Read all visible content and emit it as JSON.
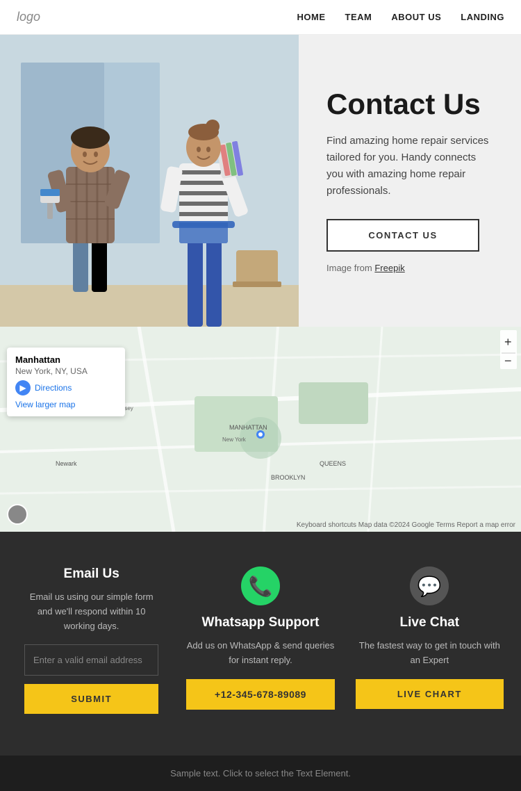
{
  "nav": {
    "logo": "logo",
    "links": [
      {
        "label": "HOME",
        "href": "#"
      },
      {
        "label": "TEAM",
        "href": "#"
      },
      {
        "label": "ABOUT US",
        "href": "#"
      },
      {
        "label": "LANDING",
        "href": "#"
      }
    ]
  },
  "hero": {
    "title": "Contact Us",
    "description": "Find amazing home repair services tailored for you. Handy connects you with amazing home repair professionals.",
    "contact_button": "CONTACT US",
    "image_credit_prefix": "Image from ",
    "image_credit_link": "Freepik"
  },
  "map": {
    "location_name": "Manhattan",
    "location_sub": "New York, NY, USA",
    "directions_label": "Directions",
    "view_larger_label": "View larger map",
    "map_footer": "Keyboard shortcuts  Map data ©2024 Google  Terms  Report a map error"
  },
  "contact": {
    "email_section": {
      "title": "Email Us",
      "description": "Email us using our simple form and we'll respond within 10 working days.",
      "input_placeholder": "Enter a valid email address",
      "submit_label": "SUBMIT"
    },
    "whatsapp_section": {
      "title": "Whatsapp Support",
      "description": "Add us on WhatsApp & send queries for instant reply.",
      "phone": "+12-345-678-89089"
    },
    "livechat_section": {
      "title": "Live Chat",
      "description": "The fastest way to get in touch with an Expert",
      "button_label": "LIVE CHART"
    }
  },
  "footer": {
    "sample_text": "Sample text. Click to select the Text Element."
  }
}
